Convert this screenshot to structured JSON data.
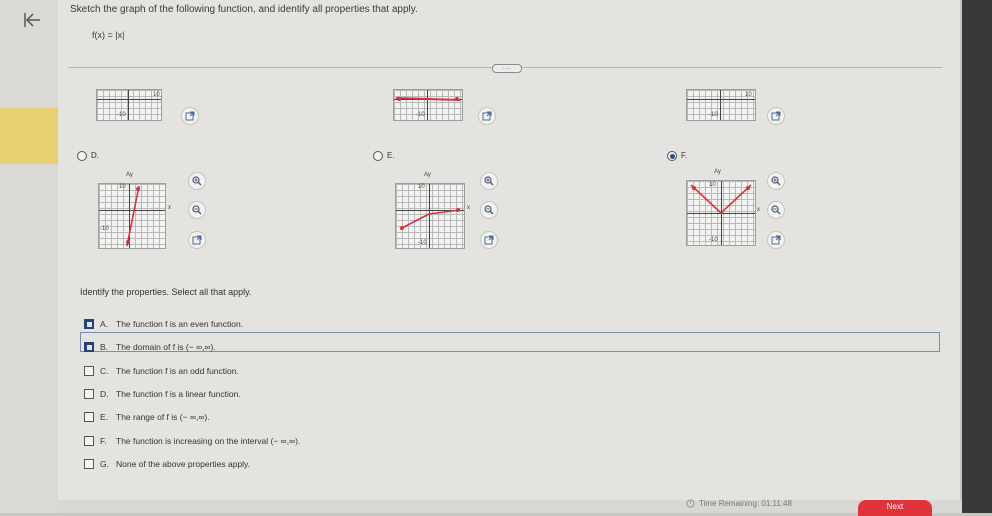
{
  "nav": {
    "back_icon": "back-arrow-icon"
  },
  "question": {
    "prompt": "Sketch the graph of the following function, and identify all properties that apply.",
    "function": "f(x) = |x|",
    "drag_label": "....."
  },
  "graphs": {
    "tick_pos": "10",
    "tick_neg": "-10",
    "axis_x": "x",
    "axis_y": "Ay",
    "top_row": [
      {
        "id": "a",
        "icons": [
          "external-link-icon"
        ]
      },
      {
        "id": "b",
        "icons": [
          "external-link-icon"
        ]
      },
      {
        "id": "c",
        "icons": [
          "external-link-icon"
        ]
      }
    ],
    "options": [
      {
        "letter": "D.",
        "selected": false,
        "icons": [
          "zoom-in-icon",
          "zoom-out-icon",
          "external-link-icon"
        ]
      },
      {
        "letter": "E.",
        "selected": false,
        "icons": [
          "zoom-in-icon",
          "zoom-out-icon",
          "external-link-icon"
        ]
      },
      {
        "letter": "F.",
        "selected": true,
        "icons": [
          "zoom-in-icon",
          "zoom-out-icon",
          "external-link-icon"
        ]
      }
    ]
  },
  "properties": {
    "title": "Identify the properties. Select all that apply.",
    "items": [
      {
        "letter": "A.",
        "text": "The function f is an even function.",
        "checked": true
      },
      {
        "letter": "B.",
        "text": "The domain of f is (− ∞,∞).",
        "checked": true
      },
      {
        "letter": "C.",
        "text": "The function f is an odd function.",
        "checked": false
      },
      {
        "letter": "D.",
        "text": "The function f is a linear function.",
        "checked": false
      },
      {
        "letter": "E.",
        "text": "The range of f is (− ∞,∞).",
        "checked": false
      },
      {
        "letter": "F.",
        "text": "The function is increasing on the interval (− ∞,∞).",
        "checked": false
      },
      {
        "letter": "G.",
        "text": "None of the above properties apply.",
        "checked": false
      }
    ]
  },
  "footer": {
    "time_remaining": "Time Remaining: 01:11:48",
    "next_label": "Next"
  },
  "colors": {
    "accent": "#e0343d",
    "selected": "#2a3f78",
    "curve": "#d8343d"
  }
}
